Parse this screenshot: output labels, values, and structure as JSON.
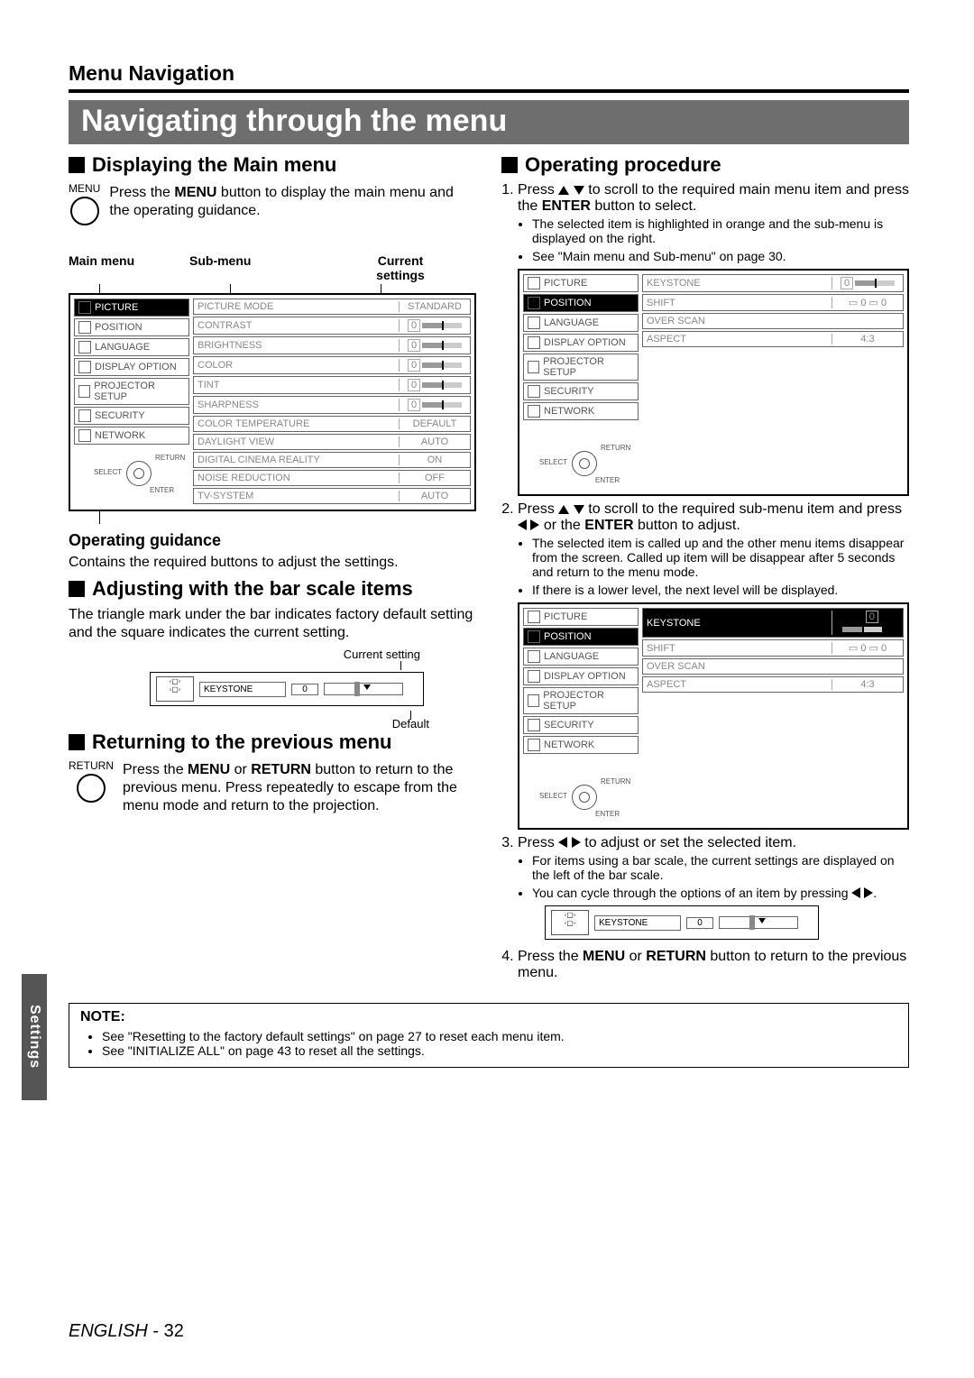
{
  "header_section": "Menu Navigation",
  "banner_title": "Navigating through the menu",
  "side_tab": "Settings",
  "footer_lang": "ENGLISH",
  "footer_page": "- 32",
  "left": {
    "h_display": "Displaying the Main menu",
    "menu_label": "MENU",
    "display_text_a": "Press the ",
    "display_text_menu": "MENU",
    "display_text_b": " button to display the main menu and the operating guidance.",
    "labels": {
      "main": "Main menu",
      "sub": "Sub-menu",
      "cur1": "Current",
      "cur2": "settings"
    },
    "main_items": [
      "PICTURE",
      "POSITION",
      "LANGUAGE",
      "DISPLAY OPTION",
      "PROJECTOR SETUP",
      "SECURITY",
      "NETWORK"
    ],
    "sub_items": [
      {
        "label": "PICTURE MODE",
        "val": "STANDARD"
      },
      {
        "label": "CONTRAST",
        "val": "0",
        "bar": true
      },
      {
        "label": "BRIGHTNESS",
        "val": "0",
        "bar": true
      },
      {
        "label": "COLOR",
        "val": "0",
        "bar": true
      },
      {
        "label": "TINT",
        "val": "0",
        "bar": true
      },
      {
        "label": "SHARPNESS",
        "val": "0",
        "bar": true
      },
      {
        "label": "COLOR TEMPERATURE",
        "val": "DEFAULT"
      },
      {
        "label": "DAYLIGHT VIEW",
        "val": "AUTO"
      },
      {
        "label": "DIGITAL CINEMA REALITY",
        "val": "ON"
      },
      {
        "label": "NOISE REDUCTION",
        "val": "OFF"
      },
      {
        "label": "TV-SYSTEM",
        "val": "AUTO"
      }
    ],
    "nav_labels": {
      "return": "RETURN",
      "select": "SELECT",
      "enter": "ENTER"
    },
    "og_title": "Operating guidance",
    "og_text": "Contains the required buttons to adjust the settings.",
    "h_adjust": "Adjusting with the bar scale items",
    "adjust_text": "The triangle mark under the bar indicates factory default setting and the square indicates the current setting.",
    "ptr_current": "Current setting",
    "ptr_default": "Default",
    "barscale_label": "KEYSTONE",
    "barscale_value": "0",
    "h_return": "Returning to the previous menu",
    "return_label": "RETURN",
    "return_text_a": "Press the ",
    "return_text_menu": "MENU",
    "return_text_b": " or ",
    "return_text_ret": "RETURN",
    "return_text_c": " button to return to the previous menu. Press repeatedly to escape from the menu mode and return to the projection."
  },
  "right": {
    "h_op": "Operating procedure",
    "step1_a": "Press ",
    "step1_b": " to scroll to the required main menu item and press the ",
    "step1_enter": "ENTER",
    "step1_c": " button to select.",
    "step1_bul1": "The selected item is highlighted in orange and the sub-menu is displayed on the right.",
    "step1_bul2": "See \"Main menu and Sub-menu\" on page 30.",
    "osd1_sub": [
      {
        "label": "KEYSTONE",
        "val": "0",
        "bar": true
      },
      {
        "label": "SHIFT",
        "val": "0  0",
        "shift": true
      },
      {
        "label": "OVER SCAN",
        "val": ""
      },
      {
        "label": "ASPECT",
        "val": "4:3"
      }
    ],
    "step2_a": "Press ",
    "step2_b": " to scroll to the required sub-menu item and press ",
    "step2_c": " or the ",
    "step2_enter": "ENTER",
    "step2_d": " button to adjust.",
    "step2_bul1": "The selected item is called up and the other menu items disappear from the screen. Called up item will be disappear after 5 seconds and return to the menu mode.",
    "step2_bul2": "If there is a lower level, the next level will be displayed.",
    "step3_a": "Press ",
    "step3_b": " to adjust or set the selected item.",
    "step3_bul1": "For items using a bar scale, the current settings are displayed on the left of the bar scale.",
    "step3_bul2": "You can cycle through the options of an item by pressing ",
    "barscale_label": "KEYSTONE",
    "barscale_value": "0",
    "step4_a": "Press the ",
    "step4_menu": "MENU",
    "step4_b": " or ",
    "step4_ret": "RETURN",
    "step4_c": " button to return to the previous menu."
  },
  "note": {
    "title": "NOTE:",
    "n1": "See \"Resetting to the factory default settings\" on page 27 to reset each menu item.",
    "n2": "See \"INITIALIZE ALL\" on page 43 to reset all the settings."
  }
}
